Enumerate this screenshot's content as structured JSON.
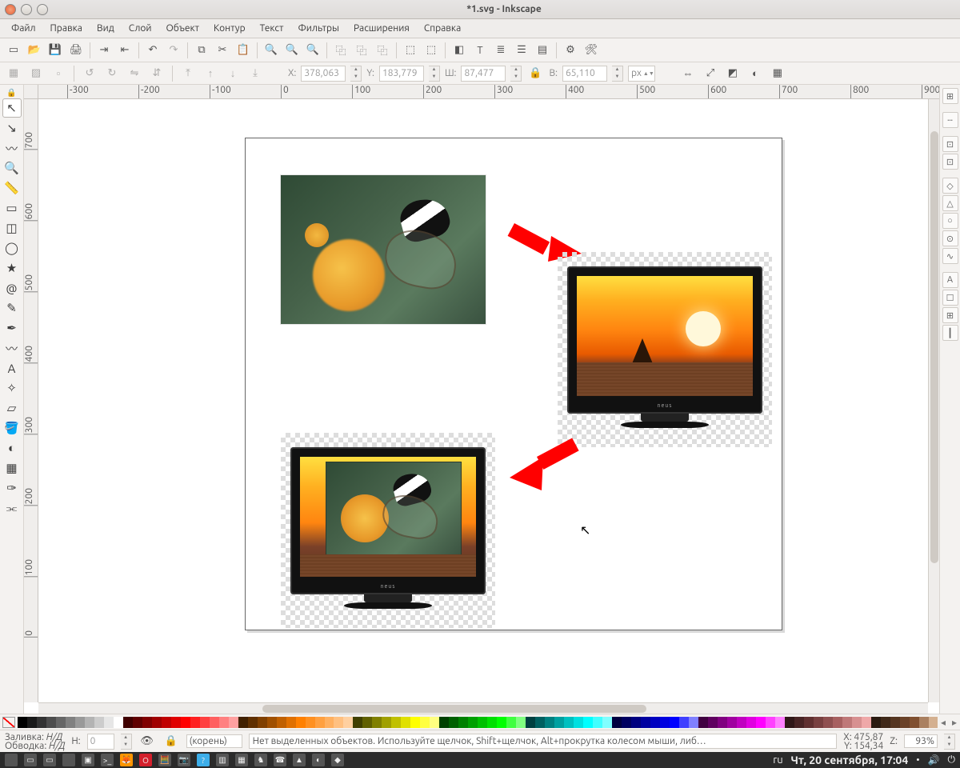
{
  "window": {
    "title": "*1.svg - Inkscape"
  },
  "menu": [
    "Файл",
    "Правка",
    "Вид",
    "Слой",
    "Объект",
    "Контур",
    "Текст",
    "Фильтры",
    "Расширения",
    "Справка"
  ],
  "toolbar_icons": [
    {
      "n": "new-icon",
      "g": "▭"
    },
    {
      "n": "open-icon",
      "g": "📂"
    },
    {
      "n": "save-icon",
      "g": "💾"
    },
    {
      "n": "print-icon",
      "g": "🖨"
    },
    {
      "n": "sep"
    },
    {
      "n": "import-icon",
      "g": "⇥"
    },
    {
      "n": "export-icon",
      "g": "⇤"
    },
    {
      "n": "sep"
    },
    {
      "n": "undo-icon",
      "g": "↶"
    },
    {
      "n": "redo-icon",
      "g": "↷",
      "d": true
    },
    {
      "n": "sep"
    },
    {
      "n": "copy-icon",
      "g": "⧉"
    },
    {
      "n": "cut-icon",
      "g": "✂"
    },
    {
      "n": "paste-icon",
      "g": "📋"
    },
    {
      "n": "sep"
    },
    {
      "n": "zoom-sel-icon",
      "g": "🔍"
    },
    {
      "n": "zoom-draw-icon",
      "g": "🔍"
    },
    {
      "n": "zoom-page-icon",
      "g": "🔍"
    },
    {
      "n": "sep"
    },
    {
      "n": "dup-icon",
      "g": "⿻"
    },
    {
      "n": "clone-icon",
      "g": "⿻"
    },
    {
      "n": "unlink-icon",
      "g": "⿻"
    },
    {
      "n": "sep"
    },
    {
      "n": "group-icon",
      "g": "⬚"
    },
    {
      "n": "ungroup-icon",
      "g": "⬚"
    },
    {
      "n": "sep"
    },
    {
      "n": "fill-dialog-icon",
      "g": "◧"
    },
    {
      "n": "text-dialog-icon",
      "g": "T"
    },
    {
      "n": "xml-icon",
      "g": "≣"
    },
    {
      "n": "align-dialog-icon",
      "g": "☰"
    },
    {
      "n": "layers-dialog-icon",
      "g": "▤"
    },
    {
      "n": "sep"
    },
    {
      "n": "prefs-icon",
      "g": "⚙"
    },
    {
      "n": "docprefs-icon",
      "g": "🛠"
    }
  ],
  "props": {
    "x_label": "X:",
    "x": "378,063",
    "y_label": "Y:",
    "y": "183,779",
    "w_label": "Ш:",
    "w": "87,477",
    "h_label": "В:",
    "h": "65,110",
    "lock": "🔒",
    "units": "px"
  },
  "ruler_h": [
    -300,
    -200,
    -100,
    0,
    100,
    200,
    300,
    400,
    500,
    600,
    700,
    800,
    900
  ],
  "ruler_v": [
    700,
    600,
    500,
    400,
    300,
    200,
    100,
    0
  ],
  "tools": [
    {
      "n": "selector-tool",
      "g": "↖",
      "active": true
    },
    {
      "n": "node-tool",
      "g": "↘"
    },
    {
      "n": "tweak-tool",
      "g": "〰"
    },
    {
      "n": "zoom-tool",
      "g": "🔍"
    },
    {
      "n": "measure-tool",
      "g": "📏"
    },
    {
      "n": "rect-tool",
      "g": "▭"
    },
    {
      "n": "3dbox-tool",
      "g": "◫"
    },
    {
      "n": "ellipse-tool",
      "g": "◯"
    },
    {
      "n": "star-tool",
      "g": "★"
    },
    {
      "n": "spiral-tool",
      "g": "@"
    },
    {
      "n": "pencil-tool",
      "g": "✎"
    },
    {
      "n": "bezier-tool",
      "g": "✒"
    },
    {
      "n": "calligraphy-tool",
      "g": "〰"
    },
    {
      "n": "text-tool",
      "g": "A"
    },
    {
      "n": "spray-tool",
      "g": "✧"
    },
    {
      "n": "eraser-tool",
      "g": "▱"
    },
    {
      "n": "bucket-tool",
      "g": "🪣"
    },
    {
      "n": "gradient-tool",
      "g": "◐"
    },
    {
      "n": "mesh-tool",
      "g": "▦"
    },
    {
      "n": "dropper-tool",
      "g": "✑"
    },
    {
      "n": "connector-tool",
      "g": "⫘"
    }
  ],
  "snap_icons": [
    "⊞",
    "┆",
    "╌",
    "┆",
    "⊡",
    "⊡",
    "┆",
    "◇",
    "△",
    "○",
    "⊙",
    "∿",
    "┆",
    "A",
    "☐",
    "⊞",
    "┃"
  ],
  "status": {
    "fill_label": "Заливка:",
    "fill_val": "Н/Д",
    "stroke_label": "Обводка:",
    "stroke_val": "Н/Д",
    "opacity_label": "Н:",
    "opacity": "0",
    "layer": "(корень)",
    "hint": "Нет выделенных объектов. Используйте щелчок, Shift+щелчок, Alt+прокрутка колесом мыши, либ…",
    "cx_label": "X:",
    "cx": "475,87",
    "cy_label": "Y:",
    "cy": "154,34",
    "z_label": "Z:",
    "zoom": "93%"
  },
  "taskbar": {
    "lang": "ru",
    "date": "Чт, 20 сентября, 17:04",
    "apps": [
      "⋮⋮⋮",
      "▭",
      "▭",
      "�about",
      "▣",
      ">_",
      "🦊",
      "O",
      "🧮",
      "📷",
      "?",
      "▥",
      "▦",
      "♞",
      "☎",
      "▲",
      "◐",
      "◆"
    ]
  },
  "palette": [
    "#000",
    "#1a1a1a",
    "#333",
    "#4d4d4d",
    "#666",
    "#808080",
    "#999",
    "#b3b3b3",
    "#ccc",
    "#e6e6e6",
    "#fff",
    "#400000",
    "#600000",
    "#800000",
    "#a00000",
    "#c00000",
    "#e00000",
    "#ff0000",
    "#ff2020",
    "#ff4040",
    "#ff6060",
    "#ff8080",
    "#ffa0a0",
    "#402000",
    "#603000",
    "#804000",
    "#a05000",
    "#c06000",
    "#e07000",
    "#ff8000",
    "#ff9020",
    "#ffa040",
    "#ffb060",
    "#ffc080",
    "#ffd0a0",
    "#404000",
    "#606000",
    "#808000",
    "#a0a000",
    "#c0c000",
    "#e0e000",
    "#ffff00",
    "#ffff40",
    "#ffff80",
    "#004000",
    "#006000",
    "#008000",
    "#00a000",
    "#00c000",
    "#00e000",
    "#00ff00",
    "#40ff40",
    "#80ff80",
    "#004040",
    "#006060",
    "#008080",
    "#00a0a0",
    "#00c0c0",
    "#00e0e0",
    "#00ffff",
    "#40ffff",
    "#80ffff",
    "#000040",
    "#000060",
    "#000080",
    "#0000a0",
    "#0000c0",
    "#0000e0",
    "#0000ff",
    "#4040ff",
    "#8080ff",
    "#400040",
    "#600060",
    "#800080",
    "#a000a0",
    "#c000c0",
    "#e000e0",
    "#ff00ff",
    "#ff40ff",
    "#ff80ff",
    "#301818",
    "#482424",
    "#603030",
    "#784040",
    "#8f5050",
    "#a76060",
    "#bf7878",
    "#d79090",
    "#efa8a8",
    "#2a1a10",
    "#3f2818",
    "#553520",
    "#6a4228",
    "#805030",
    "#aa8060",
    "#d4b090"
  ],
  "monitor_brand": "neus"
}
